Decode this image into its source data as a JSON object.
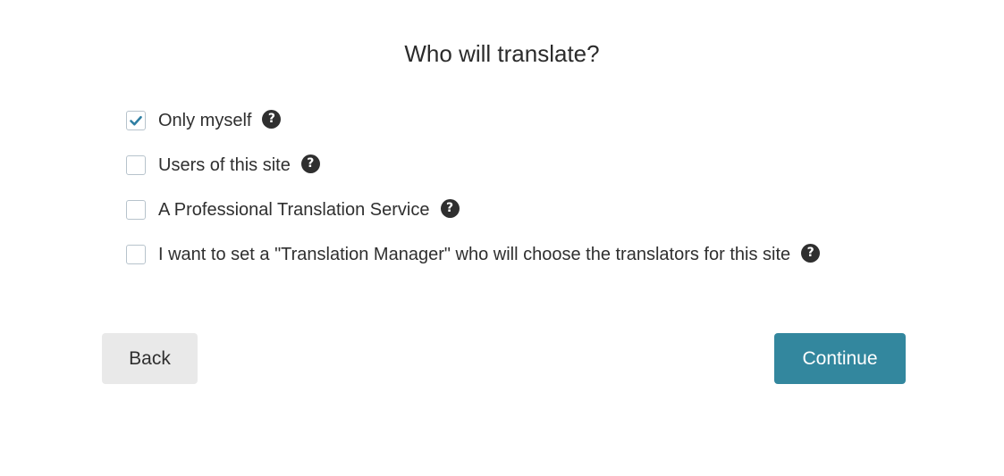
{
  "page": {
    "title": "Who will translate?"
  },
  "options": [
    {
      "label": "Only myself",
      "checked": true
    },
    {
      "label": "Users of this site",
      "checked": false
    },
    {
      "label": "A Professional Translation Service",
      "checked": false
    },
    {
      "label": "I want to set a \"Translation Manager\" who will choose the translators for this site",
      "checked": false
    }
  ],
  "help_icon": {
    "glyph": "?",
    "icon": "question-circle-icon"
  },
  "buttons": {
    "back_label": "Back",
    "continue_label": "Continue"
  },
  "colors": {
    "accent": "#33879e",
    "checkmark": "#2f7fa3",
    "checkbox_border": "#b7c3cc",
    "back_bg": "#e9e9e9",
    "help_bg": "#2f2f2f"
  }
}
